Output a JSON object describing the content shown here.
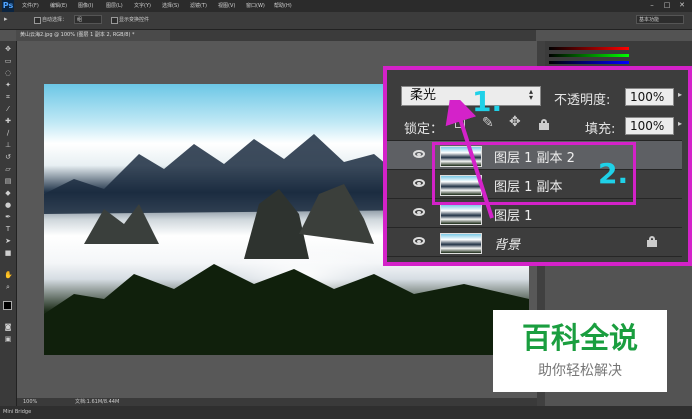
{
  "menubar": {
    "logo": "Ps",
    "items": [
      "文件(F)",
      "编辑(E)",
      "图像(I)",
      "图层(L)",
      "文字(Y)",
      "选择(S)",
      "滤镜(T)",
      "视图(V)",
      "窗口(W)",
      "帮助(H)"
    ],
    "window_controls": [
      "–",
      "□",
      "✕"
    ]
  },
  "options_bar": {
    "auto_select_label": "自动选择：",
    "auto_select_value": "组",
    "show_transform_label": "显示变换控件",
    "workspace": "基本功能"
  },
  "document_tab": {
    "title": "黄山云海2.jpg @ 100% (图层 1 副本 2, RGB/8) *"
  },
  "layers_panel": {
    "blend_mode": "柔光",
    "opacity_label": "不透明度:",
    "opacity_value": "100%",
    "lock_label": "锁定：",
    "fill_label": "填充:",
    "fill_value": "100%",
    "layers": [
      {
        "name": "图层 1 副本 2",
        "selected": true,
        "locked": false
      },
      {
        "name": "图层 1 副本",
        "selected": false,
        "locked": false
      },
      {
        "name": "图层 1",
        "selected": false,
        "locked": false
      },
      {
        "name": "背景",
        "selected": false,
        "locked": true
      }
    ]
  },
  "annotations": {
    "step1": "1.",
    "step2": "2.",
    "color": "#d422c9",
    "number_color": "#1fd1e8"
  },
  "status_bar": {
    "zoom": "100%",
    "doc_info": "文档:1.61M/8.44M",
    "mini_bridge": "Mini Bridge"
  },
  "watermark": {
    "title": "百科全说",
    "subtitle": "助你轻松解决"
  }
}
